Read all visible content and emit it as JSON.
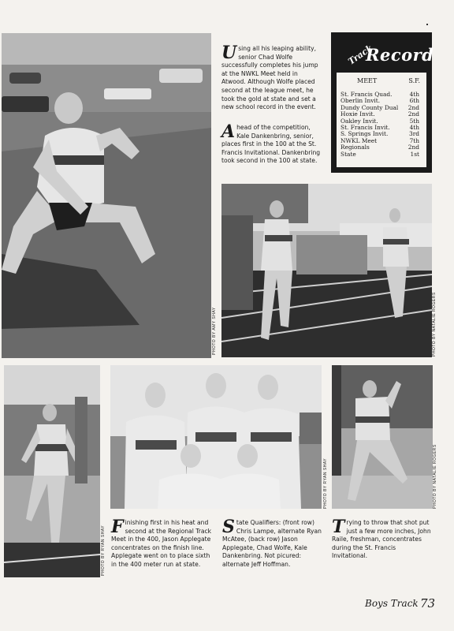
{
  "captions": {
    "wolfe": {
      "drop": "U",
      "text": "sing all his leaping ability, senior Chad Wolfe successfully completes his jump at the NWKL Meet held in Atwood. Although Wolfe placed second at the league meet, he took the gold at state and set a new school record in the event."
    },
    "dankenbring": {
      "drop": "A",
      "text": "head of the competition, Kale Dankenbring, senior, places first in the 100 at the St. Francis Invitational. Dankenbring took second in the 100 at state."
    },
    "applegate": {
      "drop": "F",
      "text": "inishing first in his heat and second at the Regional Track Meet in the 400, Jason Applegate concentrates on the finish line. Applegate went on to place sixth in the 400 meter run at state."
    },
    "qualifiers": {
      "drop": "S",
      "text": "tate Qualifiers: (front row) Chris Lampe, alternate Ryan McAtee, (back row) Jason Applegate, Chad Wolfe, Kale Dankenbring. Not picured: alternate Jeff Hoffman."
    },
    "raile": {
      "drop": "T",
      "text": "rying to throw that shot put just a few more inches, John Raile, freshman, concentrates during the St. Francis Invitational."
    }
  },
  "record": {
    "title_small": "Track",
    "title_large": "Record",
    "col_meet": "MEET",
    "col_place": "S.F.",
    "rows": [
      {
        "meet": "St. Francis Quad.",
        "place": "4th"
      },
      {
        "meet": "Oberlin Invit.",
        "place": "6th"
      },
      {
        "meet": "Dundy County Dual",
        "place": "2nd"
      },
      {
        "meet": "Hoxie Invit.",
        "place": "2nd"
      },
      {
        "meet": "Oakley Invit.",
        "place": "5th"
      },
      {
        "meet": "St. Francis Invit.",
        "place": "4th"
      },
      {
        "meet": "S. Springs Invit.",
        "place": "3rd"
      },
      {
        "meet": "NWKL Meet",
        "place": "7th"
      },
      {
        "meet": "Regionals",
        "place": "2nd"
      },
      {
        "meet": "State",
        "place": "1st"
      }
    ]
  },
  "credits": {
    "amy_shay_1": "PHOTO BY AMY SHAY",
    "natalie_rogers_1": "PHOTO BY NATALIE ROGERS",
    "ryan_shay_1": "PHOTO BY RYAN SHAY",
    "ryan_shay_2": "PHOTO BY RYAN SHAY",
    "natalie_rogers_2": "PHOTO BY NATALIE ROGERS"
  },
  "footer": {
    "section": "Boys Track",
    "page_number": "73"
  },
  "colors": {
    "paper": "#f4f2ee",
    "ink": "#1a1a1a",
    "record_box": "#1a1a1a"
  }
}
